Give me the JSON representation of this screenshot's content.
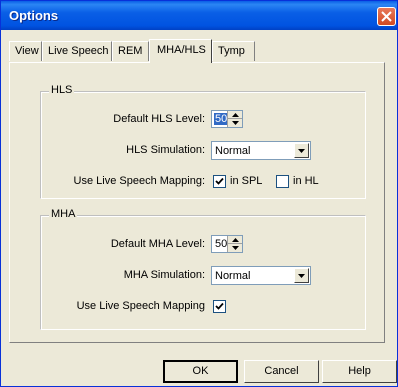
{
  "window": {
    "title": "Options"
  },
  "tabs": [
    {
      "label": "View"
    },
    {
      "label": "Live Speech"
    },
    {
      "label": "REM"
    },
    {
      "label": "MHA/HLS"
    },
    {
      "label": "Tymp"
    }
  ],
  "active_tab": "MHA/HLS",
  "hls": {
    "group_label": "HLS",
    "default_level_label": "Default HLS Level:",
    "default_level_value": "50",
    "simulation_label": "HLS Simulation:",
    "simulation_value": "Normal",
    "mapping_label": "Use Live Speech Mapping:",
    "in_spl_label": "in SPL",
    "in_spl_checked": true,
    "in_hl_label": "in HL",
    "in_hl_checked": false
  },
  "mha": {
    "group_label": "MHA",
    "default_level_label": "Default MHA Level:",
    "default_level_value": "50",
    "simulation_label": "MHA Simulation:",
    "simulation_value": "Normal",
    "mapping_label": "Use Live Speech Mapping",
    "mapping_checked": true
  },
  "buttons": {
    "ok": "OK",
    "cancel": "Cancel",
    "help": "Help"
  },
  "colors": {
    "titlebar": "#0a5fe6",
    "face": "#ece9d8",
    "selection": "#316ac5"
  }
}
